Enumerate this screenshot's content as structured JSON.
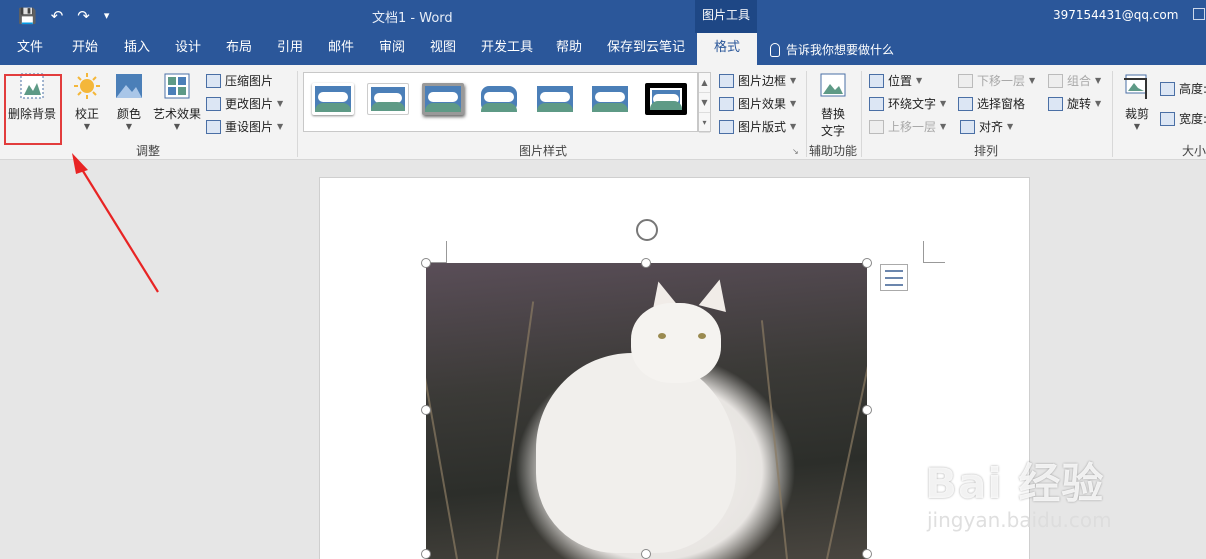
{
  "titlebar": {
    "doc_title": "文档1  -  Word",
    "context_tab": "图片工具",
    "user_email": "397154431@qq.com",
    "qat": {
      "save_icon": "save-icon",
      "undo_icon": "undo-icon",
      "redo_icon": "redo-icon",
      "customize_icon": "customize-qat-icon"
    }
  },
  "tabs": [
    {
      "label": "文件"
    },
    {
      "label": "开始"
    },
    {
      "label": "插入"
    },
    {
      "label": "设计"
    },
    {
      "label": "布局"
    },
    {
      "label": "引用"
    },
    {
      "label": "邮件"
    },
    {
      "label": "审阅"
    },
    {
      "label": "视图"
    },
    {
      "label": "开发工具"
    },
    {
      "label": "帮助"
    },
    {
      "label": "保存到云笔记"
    },
    {
      "label": "格式",
      "active": true
    }
  ],
  "tell_me": "告诉我你想要做什么",
  "ribbon": {
    "adjust": {
      "label": "调整",
      "remove_bg": "删除背景",
      "corrections": "校正",
      "color": "颜色",
      "artistic": "艺术效果",
      "compress": "压缩图片",
      "change": "更改图片",
      "reset": "重设图片"
    },
    "styles": {
      "label": "图片样式",
      "border": "图片边框",
      "effects": "图片效果",
      "layout": "图片版式"
    },
    "accessibility": {
      "label": "辅助功能",
      "alt_text_1": "替换",
      "alt_text_2": "文字"
    },
    "arrange": {
      "label": "排列",
      "position": "位置",
      "wrap": "环绕文字",
      "forward": "上移一层",
      "backward": "下移一层",
      "selection": "选择窗格",
      "align": "对齐",
      "group": "组合",
      "rotate": "旋转"
    },
    "size": {
      "label": "大小",
      "crop": "裁剪",
      "height": "高度:",
      "width": "宽度:"
    }
  },
  "watermark": {
    "logo": "Bai 经验",
    "url": "jingyan.baidu.com"
  },
  "colors": {
    "accent": "#2b579a",
    "highlight": "#e23c3c"
  }
}
